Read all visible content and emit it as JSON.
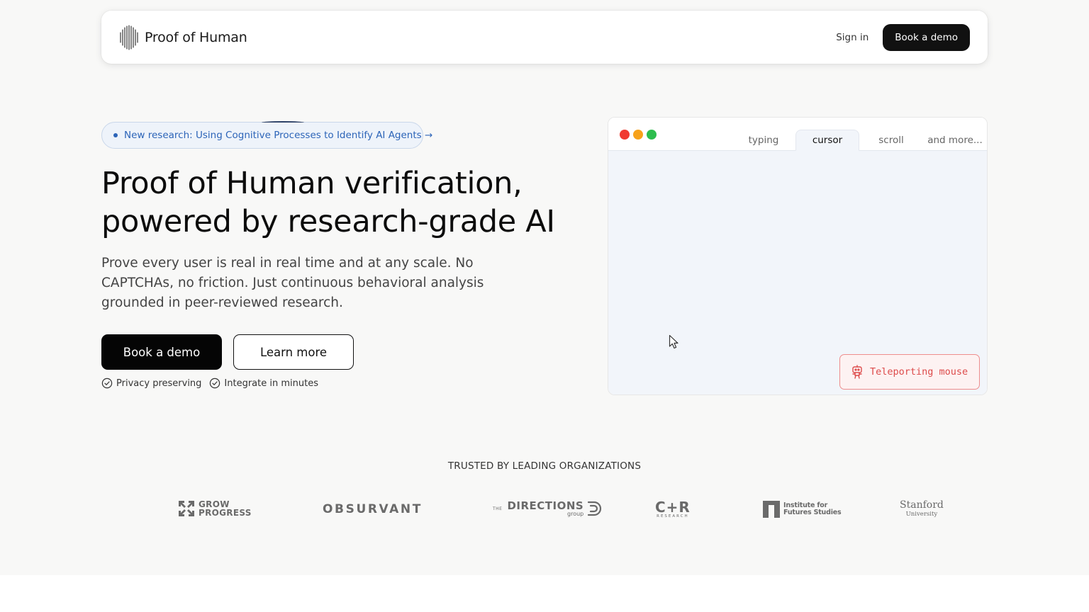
{
  "nav": {
    "brand_name": "Proof of Human",
    "sign_in": "Sign in",
    "book_demo": "Book a demo"
  },
  "hero": {
    "announcement": "New research: Using Cognitive Processes to Identify AI Agents →",
    "title_line1": "Proof of Human verification,",
    "title_line2": "powered by research-grade AI",
    "subtitle": "Prove every user is real in real time and at any scale. No CAPTCHAs, no friction. Just continuous behavioral analysis grounded in peer-reviewed research.",
    "primary_button": "Book a demo",
    "secondary_button": "Learn more",
    "features": [
      "Privacy preserving",
      "Integrate in minutes"
    ]
  },
  "demo": {
    "tabs": [
      "typing",
      "cursor",
      "scroll",
      "and more..."
    ],
    "active_tab": "cursor",
    "badge": "Teleporting mouse"
  },
  "trusted": {
    "heading": "TRUSTED BY LEADING ORGANIZATIONS",
    "logos": {
      "grow_line1": "GROW",
      "grow_line2": "PROGRESS",
      "observant": "OBSURVANT",
      "directions_prefix": "THE",
      "directions_name": "DIRECTIONS",
      "directions_sub": "group",
      "cr_name": "C+R",
      "cr_sub": "RESEARCH",
      "iff_line1": "Institute for",
      "iff_line2": "Futures Studies",
      "stanford_name": "Stanford",
      "stanford_sub": "University"
    }
  },
  "colors": {
    "background": "#f8f8f7",
    "primary": "#050505",
    "link_blue": "#2c64b8",
    "alert_red": "#dd4b4b",
    "demo_canvas": "#f2f5fa"
  }
}
